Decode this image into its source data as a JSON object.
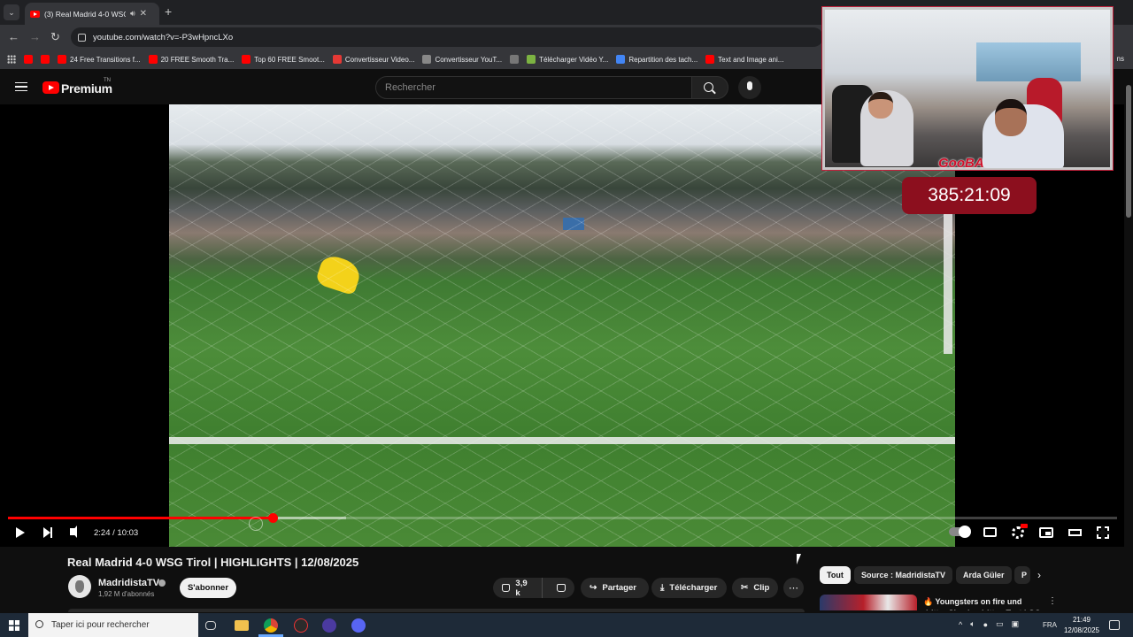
{
  "browser": {
    "tab_title": "(3) Real Madrid 4-0 WSG Ti...",
    "url": "youtube.com/watch?v=-P3wHpncLXo",
    "bookmarks": [
      {
        "label": "",
        "color": "#ff0000"
      },
      {
        "label": "",
        "color": "#ff0000"
      },
      {
        "label": "24 Free Transitions f...",
        "color": "#ff0000"
      },
      {
        "label": "20 FREE Smooth Tra...",
        "color": "#ff0000"
      },
      {
        "label": "Top 60 FREE Smoot...",
        "color": "#ff0000"
      },
      {
        "label": "Convertisseur Video...",
        "color": "#e53935"
      },
      {
        "label": "Convertisseur YouT...",
        "color": "#888888"
      },
      {
        "label": "",
        "color": "#777777"
      },
      {
        "label": "Télécharger Vidéo Y...",
        "color": "#7cb342"
      },
      {
        "label": "Repartition des tach...",
        "color": "#4285f4"
      },
      {
        "label": "Text and Image ani...",
        "color": "#ff0000"
      }
    ],
    "bookmarks_end": "ns"
  },
  "youtube": {
    "brand": "Premium",
    "country_code": "TN",
    "search_placeholder": "Rechercher"
  },
  "stream_overlay": {
    "tag": "GooBA",
    "timer": "385:21:09"
  },
  "player": {
    "time": "2:24 / 10:03",
    "progress_fraction": 0.239,
    "buffered_fraction": 0.305
  },
  "video": {
    "title": "Real Madrid 4-0 WSG Tirol | HIGHLIGHTS | 12/08/2025",
    "channel": "MadridistaTV",
    "subscribers": "1,92 M d'abonnés",
    "subscribe_label": "S'abonner",
    "likes": "3,9 k",
    "share_label": "Partager",
    "download_label": "Télécharger",
    "clip_label": "Clip"
  },
  "chips": [
    "Tout",
    "Source : MadridistaTV",
    "Arda Güler",
    "P"
  ],
  "suggestion": {
    "title": "🔥 Youngsters on fire und dritter Sieg im dritten Test | GC Züric"
  },
  "taskbar": {
    "search_placeholder": "Taper ici pour rechercher",
    "lang": "FRA",
    "time": "21:49",
    "date": "12/08/2025"
  },
  "colors": {
    "accent": "#ff0000",
    "timer_bg": "#8c0f1e"
  }
}
